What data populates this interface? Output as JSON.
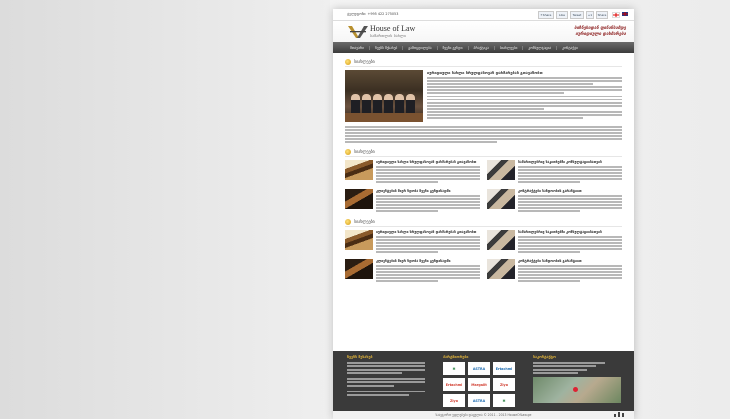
{
  "topbar": {
    "phone": "ტელეფონი: +995 422 275053",
    "social": [
      "f Share",
      "Like",
      "Tweet",
      "+1",
      "Share"
    ],
    "flags": [
      "georgia-flag",
      "uk-flag"
    ]
  },
  "header": {
    "logo_title": "House of Law",
    "logo_subtitle": "სამართლის სახლი",
    "slogan_line1": "ბიზნესიდან ფინანსამდე",
    "slogan_line2": "იურიდიული დახმარება"
  },
  "nav": [
    "მთავარი",
    "ჩვენს შესახებ",
    "გამოცდილება",
    "ჩვენი გუნდი",
    "პრაქტიკა",
    "სიახლეები",
    "კონსულტაცია",
    "კონტაქტი"
  ],
  "sections": {
    "news_title": "სიახლეები",
    "lead_headline": "იურიდიული სახლი სრულფასოვან დახმარებას გთავაზობთ",
    "grid_title": "სიახლეები",
    "grid2_title": "სიახლეები"
  },
  "news_grid": [
    {
      "headline": "იურიდიული სახლი სრულფასოვან დახმარებას გთავაზობთ",
      "img": "gavel"
    },
    {
      "headline": "სამართლებრივ საკითხებში კონსულტაციისათვის",
      "img": "signing"
    },
    {
      "headline": "კლიენტების მიერ ნდობა ჩვენი გუნდისადმი",
      "img": "gavel-dark"
    },
    {
      "headline": "კონტრაქტები სანდოობის გარანტიით",
      "img": "signing"
    }
  ],
  "news_grid2": [
    {
      "headline": "იურიდიული სახლი სრულფასოვან დახმარებას გთავაზობთ",
      "img": "gavel"
    },
    {
      "headline": "სამართლებრივ საკითხებში კონსულტაციისათვის",
      "img": "signing"
    },
    {
      "headline": "კლიენტების მიერ ნდობა ჩვენი გუნდისადმი",
      "img": "gavel-dark"
    },
    {
      "headline": "კონტრაქტები სანდოობის გარანტიით",
      "img": "signing"
    }
  ],
  "footer": {
    "about_title": "ჩვენს შესახებ",
    "partners_title": "პარტნიორები",
    "contact_title": "საკონტაქტო",
    "partners": [
      {
        "name": "H",
        "color": "#1e7c3a"
      },
      {
        "name": "ASTRA",
        "color": "#1a6ab0"
      },
      {
        "name": "Ertachmi",
        "color": "#1a6ab0"
      },
      {
        "name": "Ertachmi",
        "color": "#d0392b"
      },
      {
        "name": "Margalit",
        "color": "#d0392b"
      },
      {
        "name": "Ziyo",
        "color": "#d0392b"
      },
      {
        "name": "Ziyo",
        "color": "#d0392b"
      },
      {
        "name": "ASTRA",
        "color": "#1a6ab0"
      },
      {
        "name": "H",
        "color": "#1e7c3a"
      }
    ]
  },
  "copyright": "საავტორო უფლებები დაცულია © 2011 - 2013 HouseOfLaw.ge"
}
